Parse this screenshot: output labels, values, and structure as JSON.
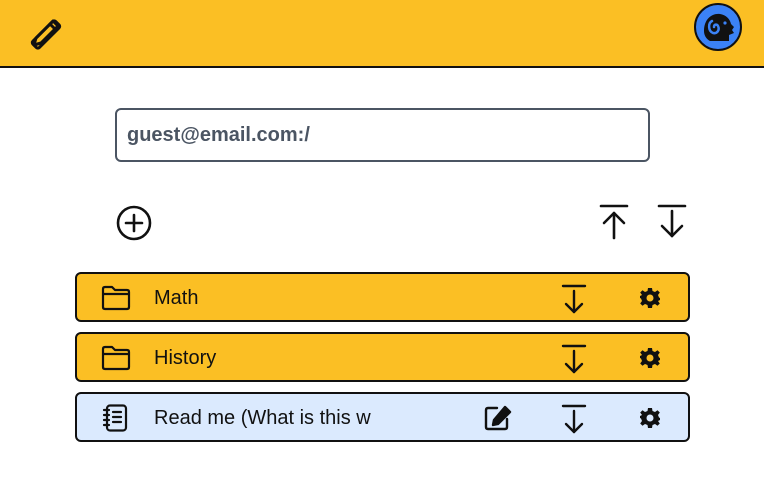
{
  "header": {
    "logo_icon": "pencil-ruler-icon",
    "avatar_icon": "ram-avatar-icon",
    "bar_color": "#fbbf24",
    "avatar_color": "#3b82f6"
  },
  "path": {
    "value": "guest@email.com:/"
  },
  "toolbar": {
    "add_icon": "plus-circle-icon",
    "upload_icon": "arrow-up-to-line-icon",
    "download_icon": "arrow-down-to-line-icon"
  },
  "items": [
    {
      "type": "folder",
      "label": "Math",
      "icon": "folder-icon",
      "color": "#fbbf24"
    },
    {
      "type": "folder",
      "label": "History",
      "icon": "folder-icon",
      "color": "#fbbf24"
    },
    {
      "type": "file",
      "label": "Read me (What is this w",
      "icon": "notebook-icon",
      "color": "#dbeafe"
    }
  ]
}
